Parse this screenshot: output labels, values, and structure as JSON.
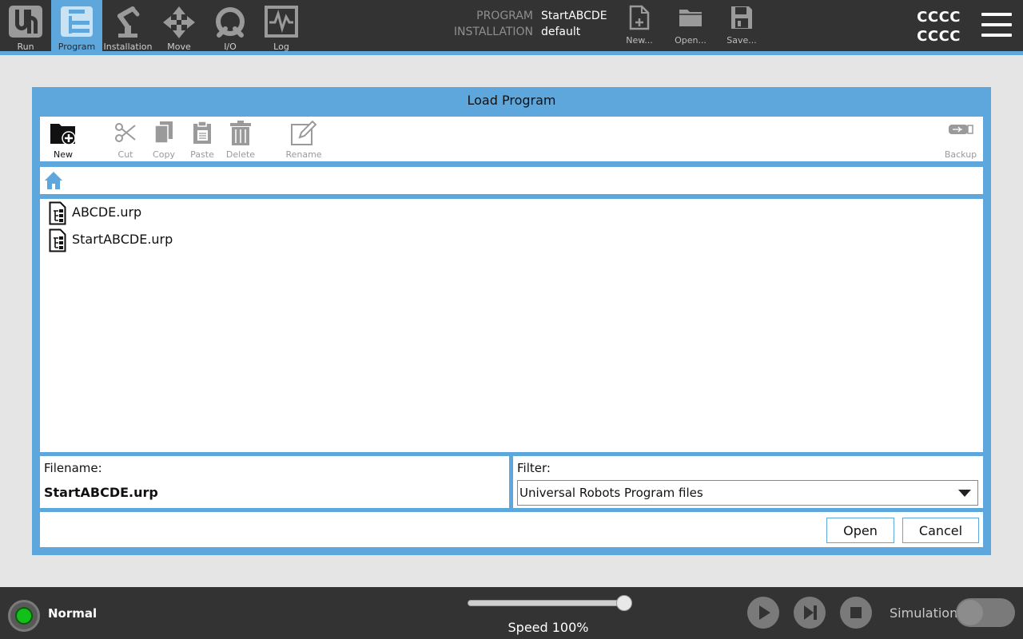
{
  "nav": {
    "items": [
      {
        "label": "Run",
        "icon": "ur-logo-icon"
      },
      {
        "label": "Program",
        "icon": "program-tree-icon",
        "active": true
      },
      {
        "label": "Installation",
        "icon": "robot-arm-icon"
      },
      {
        "label": "Move",
        "icon": "move-arrows-icon"
      },
      {
        "label": "I/O",
        "icon": "io-icon"
      },
      {
        "label": "Log",
        "icon": "log-chart-icon"
      }
    ]
  },
  "program_info": {
    "program_key": "PROGRAM",
    "program_value": "StartABCDE",
    "installation_key": "INSTALLATION",
    "installation_value": "default"
  },
  "file_buttons": {
    "new": "New...",
    "open": "Open...",
    "save": "Save..."
  },
  "user": {
    "line1": "CCCC",
    "line2": "CCCC"
  },
  "dialog": {
    "title": "Load Program",
    "toolbar": {
      "new": "New",
      "cut": "Cut",
      "copy": "Copy",
      "paste": "Paste",
      "delete": "Delete",
      "rename": "Rename",
      "backup": "Backup"
    },
    "files": [
      {
        "name": "ABCDE.urp"
      },
      {
        "name": "StartABCDE.urp"
      }
    ],
    "filename_label": "Filename:",
    "filename_value": "StartABCDE.urp",
    "filter_label": "Filter:",
    "filter_value": "Universal Robots Program files",
    "open_button": "Open",
    "cancel_button": "Cancel"
  },
  "bottom": {
    "status": "Normal",
    "speed_text": "Speed 100%",
    "speed_value": 100,
    "simulation_label": "Simulation",
    "simulation_on": false
  },
  "colors": {
    "accent": "#5ea7dc",
    "bar": "#333333",
    "background": "#e5e5e5",
    "status_green": "#11c11a"
  }
}
